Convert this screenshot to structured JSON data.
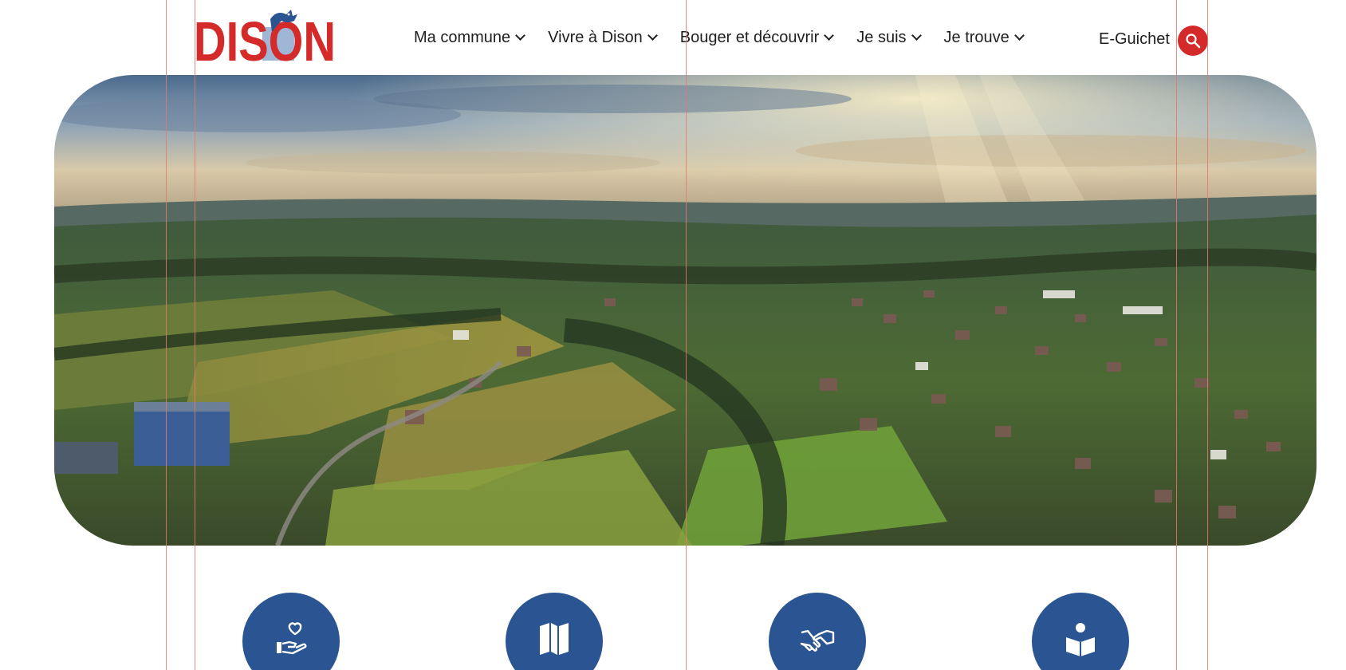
{
  "site": {
    "logo_text": "DISON"
  },
  "nav": {
    "items": [
      {
        "label": "Ma commune"
      },
      {
        "label": "Vivre à Dison"
      },
      {
        "label": "Bouger et découvrir"
      },
      {
        "label": "Je suis"
      },
      {
        "label": "Je trouve"
      }
    ],
    "eguichet_label": "E-Guichet",
    "search_icon": "search-icon"
  },
  "hero": {
    "image": "aerial view of Dison countryside at sunset"
  },
  "quicklinks": [
    {
      "icon": "hand-heart-icon"
    },
    {
      "icon": "map-icon"
    },
    {
      "icon": "handshake-icon"
    },
    {
      "icon": "reader-icon"
    }
  ],
  "colors": {
    "brand_red": "#d42a2a",
    "brand_blue": "#2a5592",
    "guide_line": "#e8786b"
  }
}
